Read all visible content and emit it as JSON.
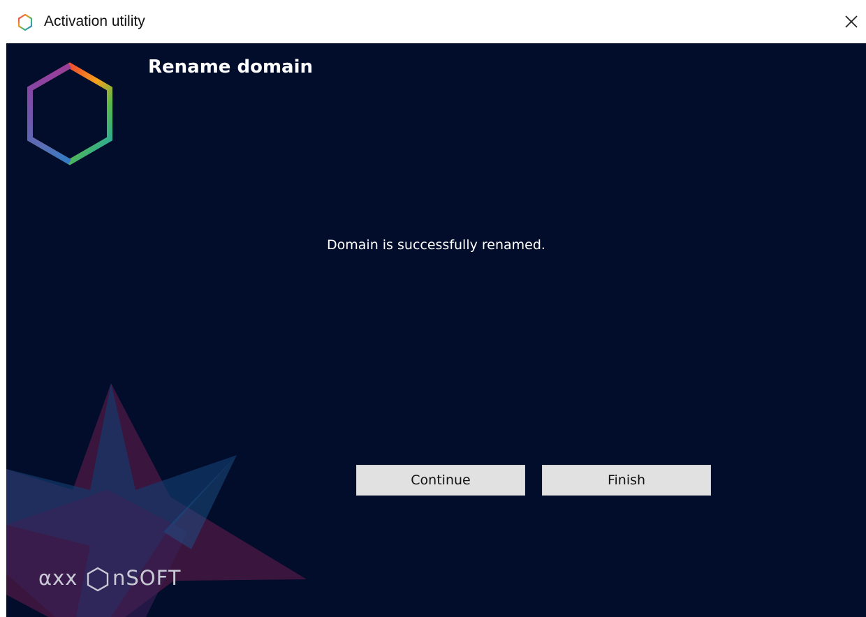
{
  "window": {
    "title": "Activation utility",
    "close_icon": "close-icon",
    "app_icon": "hexagon-icon"
  },
  "page": {
    "heading": "Rename domain",
    "message": "Domain is successfully renamed."
  },
  "buttons": {
    "continue_label": "Continue",
    "finish_label": "Finish"
  },
  "branding": {
    "logo_text": "axxonsoft",
    "logo_icon": "axxonsoft-hexagon-logo"
  },
  "colors": {
    "background": "#020c2b",
    "button_bg": "#e1e1e1",
    "text": "#ffffff"
  }
}
